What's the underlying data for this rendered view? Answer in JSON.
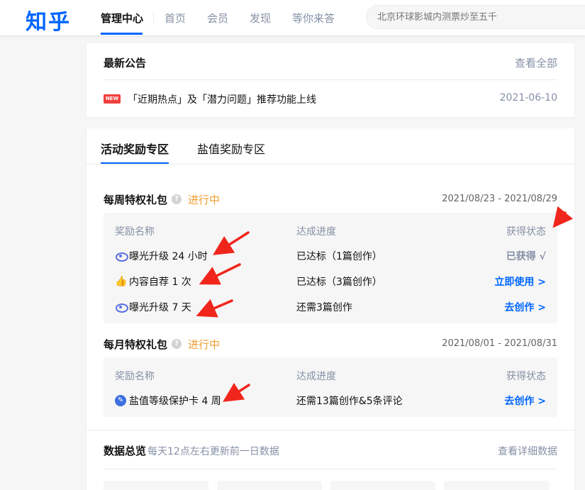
{
  "header": {
    "logo": "知乎",
    "nav": [
      "管理中心",
      "首页",
      "会员",
      "发现",
      "等你来答"
    ],
    "search_placeholder": "北京环球影城内测票炒至五千"
  },
  "announcement": {
    "title": "最新公告",
    "view_all": "查看全部",
    "badge": "NEW",
    "text": "「近期热点」及「潜力问题」推荐功能上线",
    "date": "2021-06-10"
  },
  "tabs": [
    "活动奖励专区",
    "盐值奖励专区"
  ],
  "weekly": {
    "title": "每周特权礼包",
    "help": "?",
    "status": "进行中",
    "dates": "2021/08/23 - 2021/08/29",
    "col_name": "奖励名称",
    "col_progress": "达成进度",
    "col_state": "获得状态",
    "rows": [
      {
        "icon": "eye-icon",
        "name": "曝光升级 24 小时",
        "progress": "已达标（1篇创作）",
        "action": "已获得 √"
      },
      {
        "icon": "thumbs-up-icon",
        "name": "内容自荐 1 次",
        "progress": "已达标（3篇创作）",
        "action": "立即使用 >"
      },
      {
        "icon": "eye-icon",
        "name": "曝光升级 7 天",
        "progress": "还需3篇创作",
        "action": "去创作 >"
      }
    ]
  },
  "monthly": {
    "title": "每月特权礼包",
    "help": "?",
    "status": "进行中",
    "dates": "2021/08/01 - 2021/08/31",
    "col_name": "奖励名称",
    "col_progress": "达成进度",
    "col_state": "获得状态",
    "rows": [
      {
        "icon": "pen-icon",
        "name": "盐值等级保护卡 4 周",
        "progress": "还需13篇创作&5条评论",
        "action": "去创作 >"
      }
    ]
  },
  "data_overview": {
    "title": "数据总览",
    "subtitle": "每天12点左右更新前一日数据",
    "view_details": "查看详细数据"
  },
  "colors": {
    "brand": "#0066ff",
    "status_in_progress": "#f09e32",
    "new_badge": "#f1403c",
    "annotation_arrow": "#f0261c"
  }
}
